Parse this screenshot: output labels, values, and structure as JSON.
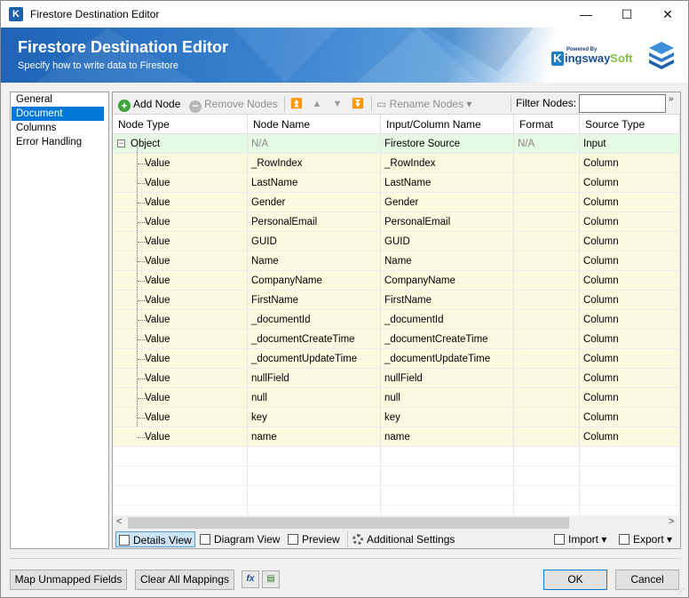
{
  "window": {
    "title": "Firestore Destination Editor",
    "icon": "K"
  },
  "titlebar_buttons": {
    "minimize": "—",
    "maximize": "☐",
    "close": "✕"
  },
  "banner": {
    "title": "Firestore Destination Editor",
    "subtitle": "Specify how to write data to Firestore",
    "logo_small": "Powered By",
    "logo_k": "K",
    "logo_main": "ingsway",
    "logo_soft": "Soft"
  },
  "nav": {
    "items": [
      {
        "label": "General",
        "selected": false
      },
      {
        "label": "Document Designer",
        "selected": true
      },
      {
        "label": "Columns",
        "selected": false
      },
      {
        "label": "Error Handling",
        "selected": false
      }
    ]
  },
  "toolbar": {
    "add_node": "Add Node",
    "remove_nodes": "Remove Nodes",
    "rename_nodes": "Rename Nodes",
    "filter_label": "Filter Nodes:",
    "filter_value": "",
    "more": "»"
  },
  "grid": {
    "columns": [
      "Node Type",
      "Node Name",
      "Input/Column Name",
      "Format String",
      "Source Type"
    ],
    "root": {
      "type": "Object",
      "name": "N/A",
      "input": "Firestore Source",
      "format": "N/A",
      "source": "Input"
    },
    "rows": [
      {
        "type": "Value",
        "name": "_RowIndex",
        "input": "_RowIndex",
        "format": "",
        "source": "Column"
      },
      {
        "type": "Value",
        "name": "LastName",
        "input": "LastName",
        "format": "",
        "source": "Column"
      },
      {
        "type": "Value",
        "name": "Gender",
        "input": "Gender",
        "format": "",
        "source": "Column"
      },
      {
        "type": "Value",
        "name": "PersonalEmail",
        "input": "PersonalEmail",
        "format": "",
        "source": "Column"
      },
      {
        "type": "Value",
        "name": "GUID",
        "input": "GUID",
        "format": "",
        "source": "Column"
      },
      {
        "type": "Value",
        "name": "Name",
        "input": "Name",
        "format": "",
        "source": "Column"
      },
      {
        "type": "Value",
        "name": "CompanyName",
        "input": "CompanyName",
        "format": "",
        "source": "Column"
      },
      {
        "type": "Value",
        "name": "FirstName",
        "input": "FirstName",
        "format": "",
        "source": "Column"
      },
      {
        "type": "Value",
        "name": "_documentId",
        "input": "_documentId",
        "format": "",
        "source": "Column"
      },
      {
        "type": "Value",
        "name": "_documentCreateTime",
        "input": "_documentCreateTime",
        "format": "",
        "source": "Column"
      },
      {
        "type": "Value",
        "name": "_documentUpdateTime",
        "input": "_documentUpdateTime",
        "format": "",
        "source": "Column"
      },
      {
        "type": "Value",
        "name": "nullField",
        "input": "nullField",
        "format": "",
        "source": "Column"
      },
      {
        "type": "Value",
        "name": "null",
        "input": "null",
        "format": "",
        "source": "Column"
      },
      {
        "type": "Value",
        "name": "key",
        "input": "key",
        "format": "",
        "source": "Column"
      },
      {
        "type": "Value",
        "name": "name",
        "input": "name",
        "format": "",
        "source": "Column"
      }
    ]
  },
  "viewbar": {
    "details_view": "Details View",
    "diagram_view": "Diagram View",
    "preview": "Preview",
    "additional_settings": "Additional Settings",
    "import": "Import",
    "export": "Export"
  },
  "footer": {
    "map_unmapped": "Map Unmapped Fields",
    "clear_mappings": "Clear All Mappings",
    "fx": "fx",
    "ok": "OK",
    "cancel": "Cancel"
  },
  "colors": {
    "accent": "#0078d7",
    "banner": "#1e63b6",
    "object_row": "#e5fae2",
    "value_row": "#fbfae0"
  }
}
